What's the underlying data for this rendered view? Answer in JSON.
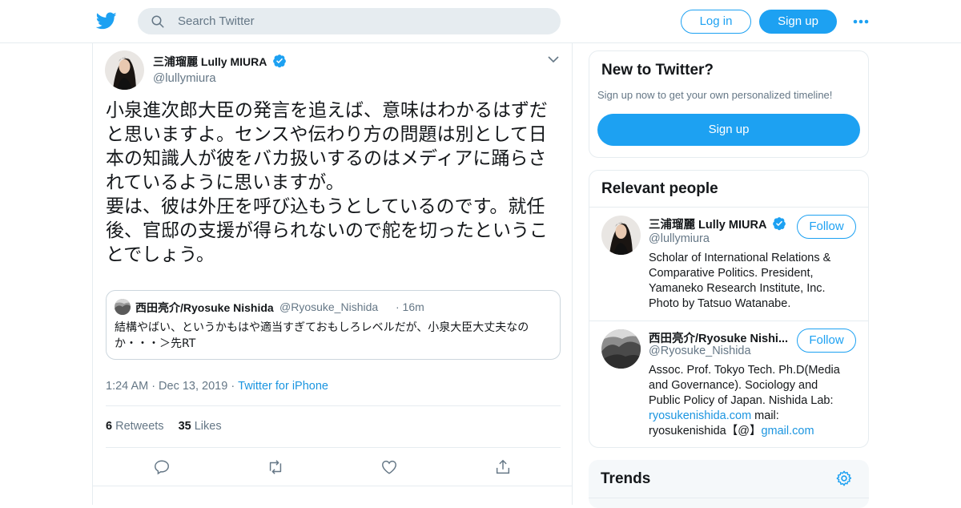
{
  "topbar": {
    "search_placeholder": "Search Twitter",
    "login_label": "Log in",
    "signup_label": "Sign up"
  },
  "tweet": {
    "author_name": "三浦瑠麗 Lully MIURA",
    "author_handle": "@lullymiura",
    "text": "小泉進次郎大臣の発言を追えば、意味はわかるはずだと思いますよ。センスや伝わり方の問題は別として日本の知識人が彼をバカ扱いするのはメディアに踊らされているように思いますが。\n要は、彼は外圧を呼び込もうとしているのです。就任後、官邸の支援が得られないので舵を切ったということでしょう。",
    "quote": {
      "name": "西田亮介/Ryosuke Nishida",
      "handle": "@Ryosuke_Nishida",
      "time": "· 16m",
      "text": "結構やばい、というかもはや適当すぎておもしろレベルだが、小泉大臣大丈夫なのか・・・＞先RT"
    },
    "time": "1:24 AM",
    "date": "Dec 13, 2019",
    "source": "Twitter for iPhone",
    "retweets_count": "6",
    "retweets_label": "Retweets",
    "likes_count": "35",
    "likes_label": "Likes"
  },
  "sidebar": {
    "new_to_twitter": {
      "title": "New to Twitter?",
      "subtitle": "Sign up now to get your own personalized timeline!",
      "signup_label": "Sign up"
    },
    "relevant_people": {
      "title": "Relevant people",
      "people": [
        {
          "name": "三浦瑠麗 Lully MIURA",
          "handle": "@lullymiura",
          "bio": "Scholar of International Relations & Comparative Politics. President, Yamaneko Research Institute, Inc. Photo by Tatsuo Watanabe.",
          "follow_label": "Follow"
        },
        {
          "name": "西田亮介/Ryosuke Nishi...",
          "handle": "@Ryosuke_Nishida",
          "bio_text": "Assoc. Prof. Tokyo Tech. Ph.D(Media and Governance). Sociology and Public Policy of Japan. Nishida Lab: ",
          "bio_link1": "ryosukenishida.com",
          "bio_mid": " mail: ryosukenishida【@】",
          "bio_link2": "gmail.com",
          "follow_label": "Follow"
        }
      ]
    },
    "trends": {
      "title": "Trends"
    }
  },
  "colors": {
    "accent": "#1da1f2",
    "link": "#1b95e0",
    "muted": "#657786",
    "border": "#e6ecf0"
  },
  "icons": [
    "twitter-bird-icon",
    "search-icon",
    "more-dots-icon",
    "verified-icon",
    "chevron-down-icon",
    "reply-icon",
    "retweet-icon",
    "like-icon",
    "share-icon",
    "gear-icon"
  ]
}
